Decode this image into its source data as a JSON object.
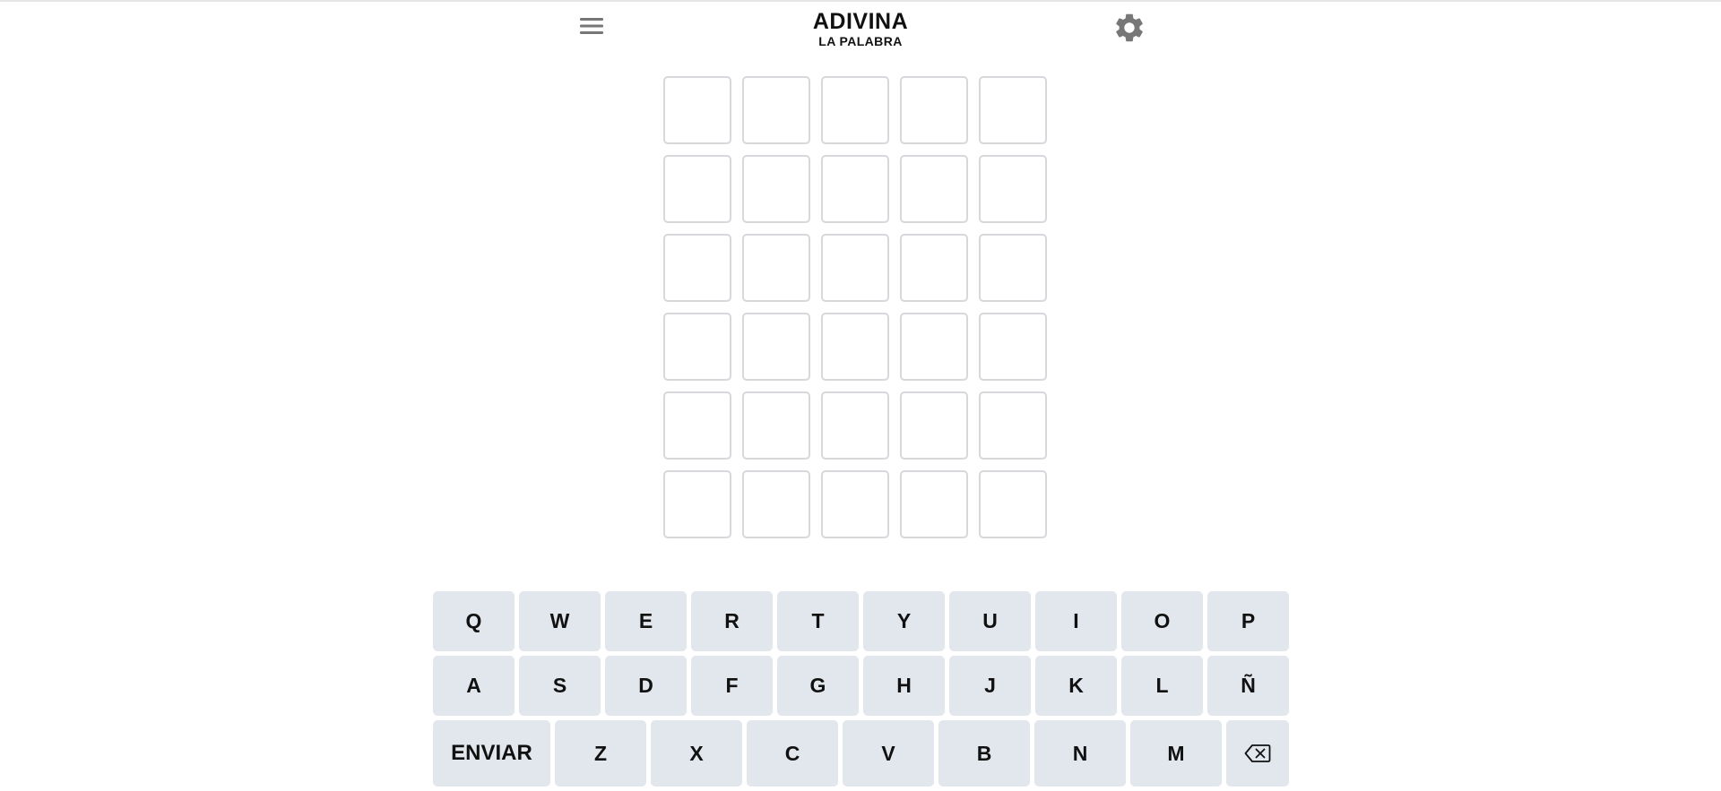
{
  "header": {
    "title": "ADIVINA",
    "subtitle": "LA PALABRA",
    "menu_icon": "hamburger-menu-icon",
    "settings_icon": "gear-icon"
  },
  "board": {
    "rows": [
      [
        "",
        "",
        "",
        "",
        ""
      ],
      [
        "",
        "",
        "",
        "",
        ""
      ],
      [
        "",
        "",
        "",
        "",
        ""
      ],
      [
        "",
        "",
        "",
        "",
        ""
      ],
      [
        "",
        "",
        "",
        "",
        ""
      ],
      [
        "",
        "",
        "",
        "",
        ""
      ]
    ]
  },
  "keyboard": {
    "row1": [
      "Q",
      "W",
      "E",
      "R",
      "T",
      "Y",
      "U",
      "I",
      "O",
      "P"
    ],
    "row2": [
      "A",
      "S",
      "D",
      "F",
      "G",
      "H",
      "J",
      "K",
      "L",
      "Ñ"
    ],
    "row3": [
      "ENVIAR",
      "Z",
      "X",
      "C",
      "V",
      "B",
      "N",
      "M",
      "⌫"
    ],
    "enter_label": "ENVIAR",
    "backspace_icon": "backspace-icon"
  },
  "colors": {
    "key_bg": "#e2e6ed",
    "tile_border": "#d6d8db",
    "icon_gray": "#777777"
  }
}
